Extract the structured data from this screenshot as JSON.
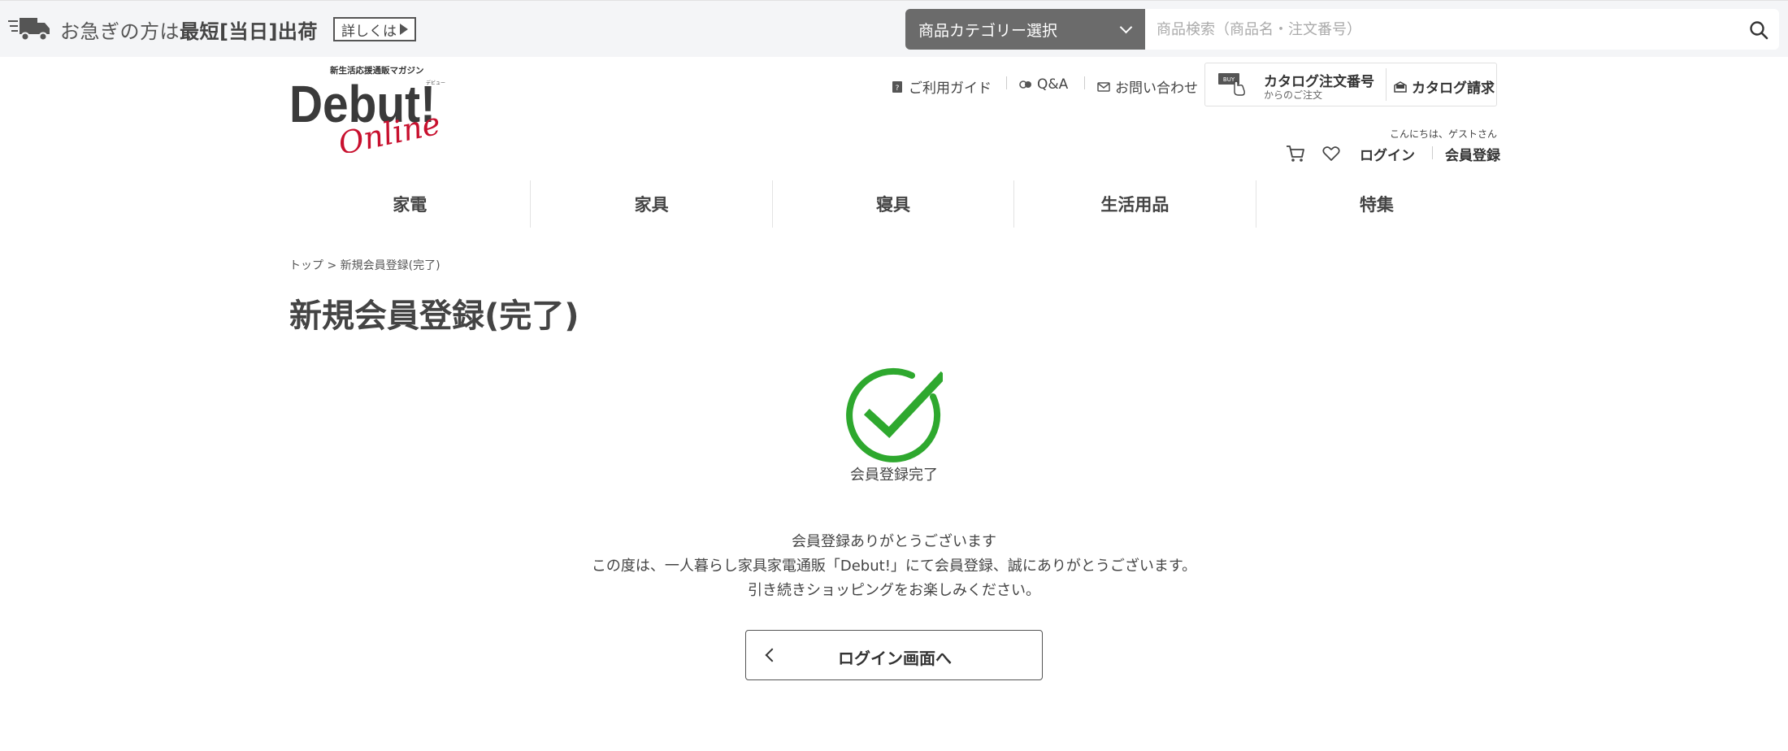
{
  "topbar": {
    "promo_pre": "お急ぎの方は",
    "promo_bold": "最短[当日]出荷",
    "details_label": "詳しくは",
    "category_select": "商品カテゴリー選択",
    "search_placeholder": "商品検索（商品名・注文番号）"
  },
  "header": {
    "logo_tagline": "新生活応援通販マガジン",
    "logo_ruby": "デビュー",
    "logo_main": "Debut!",
    "logo_script": "Online",
    "util_links": {
      "guide": "ご利用ガイド",
      "qa": "Q&A",
      "contact": "お問い合わせ"
    },
    "catalog_order_title": "カタログ注文番号",
    "catalog_order_sub": "からのご注文",
    "catalog_order_badge": "BUY",
    "catalog_request": "カタログ請求",
    "greeting": "こんにちは、ゲストさん",
    "login": "ログイン",
    "register": "会員登録"
  },
  "nav": {
    "items": [
      "家電",
      "家具",
      "寝具",
      "生活用品",
      "特集"
    ]
  },
  "content": {
    "breadcrumb": "トップ > 新規会員登録(完了)",
    "title": "新規会員登録(完了)",
    "complete_label": "会員登録完了",
    "message_lines": [
      "会員登録ありがとうございます",
      "この度は、一人暮らし家具家電通販「Debut!」にて会員登録、誠にありがとうございます。",
      "引き続きショッピングをお楽しみください。"
    ],
    "login_button": "ログイン画面へ"
  },
  "colors": {
    "check_green": "#2ea82e",
    "logo_red": "#c8102e",
    "select_gray": "#6b6b6b",
    "topbar_bg": "#f4f5f7"
  }
}
